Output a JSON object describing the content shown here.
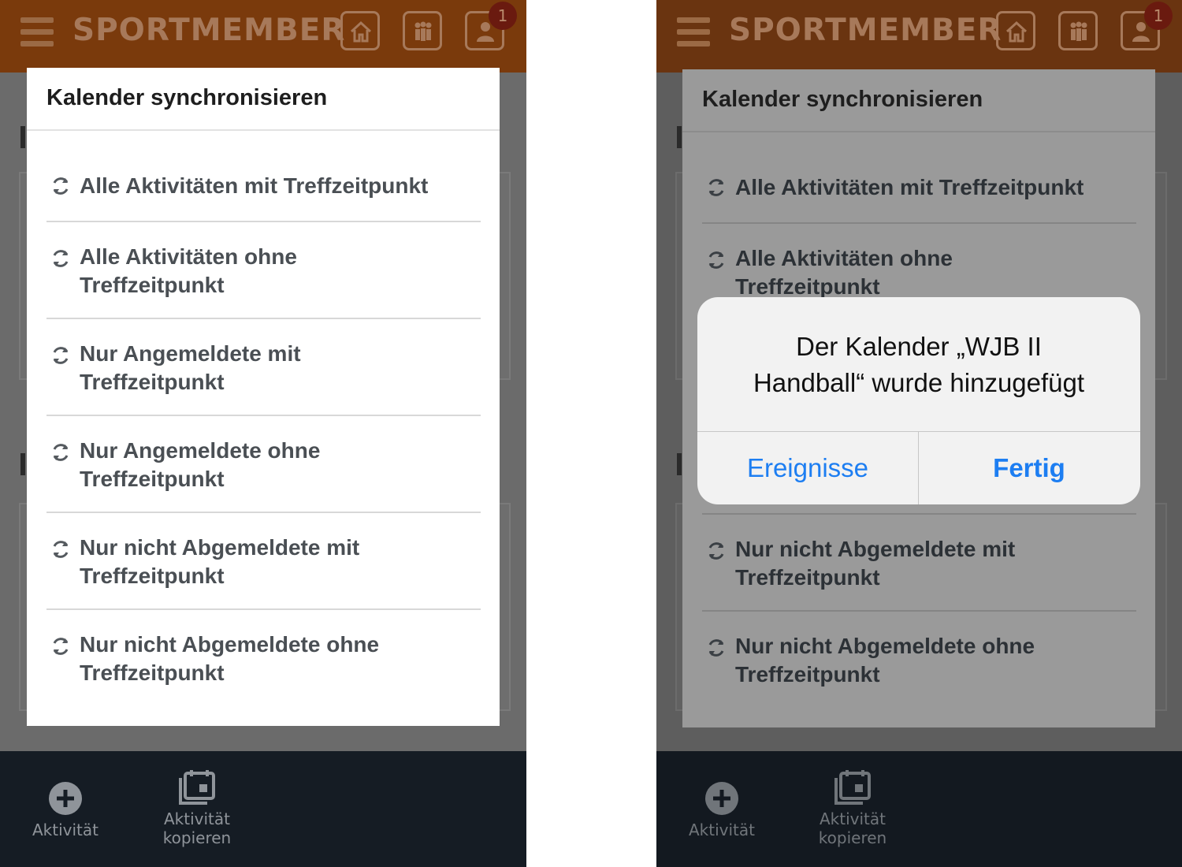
{
  "app": {
    "brand": "SPORTMEMBER",
    "notification_count": "1",
    "colors": {
      "topbar": "#7a3a0c",
      "modal": "#ffffff",
      "bottom_nav": "#151c24",
      "alert_button": "#1d7ef2"
    }
  },
  "modal": {
    "title": "Kalender synchronisieren",
    "options": [
      {
        "line1": "Alle Aktivitäten mit Treffzeitpunkt",
        "line2": ""
      },
      {
        "line1": "Alle Aktivitäten ohne",
        "line2": "Treffzeitpunkt"
      },
      {
        "line1": "Nur Angemeldete mit",
        "line2": "Treffzeitpunkt"
      },
      {
        "line1": "Nur Angemeldete ohne",
        "line2": "Treffzeitpunkt"
      },
      {
        "line1": "Nur nicht Abgemeldete mit",
        "line2": "Treffzeitpunkt"
      },
      {
        "line1": "Nur nicht Abgemeldete ohne",
        "line2": "Treffzeitpunkt"
      }
    ],
    "option_icon": "sync-icon"
  },
  "bottom_nav": {
    "items": [
      {
        "label": "Aktivität",
        "icon": "plus-circle-icon"
      },
      {
        "label_line1": "Aktivität",
        "label_line2": "kopieren",
        "icon": "copy-calendar-icon"
      }
    ]
  },
  "alert": {
    "message_line1": "Der Kalender „WJB II",
    "message_line2": "Handball“ wurde hinzugefügt",
    "left_button": "Ereignisse",
    "right_button": "Fertig"
  }
}
